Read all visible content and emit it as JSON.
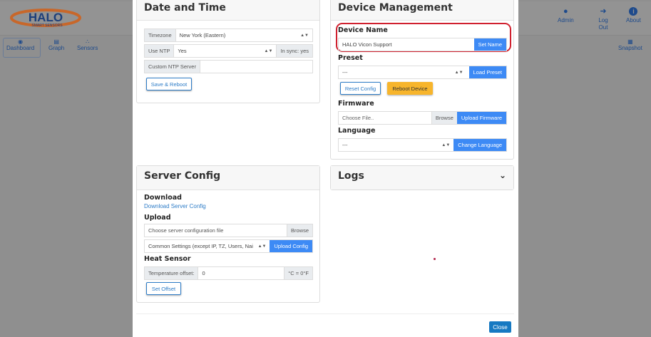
{
  "app": {
    "logo_text": "HALO",
    "logo_sub": "SMART SENSORS"
  },
  "nav": [
    {
      "label": "Dashboard",
      "icon": "dashboard-icon"
    },
    {
      "label": "Graph",
      "icon": "graph-icon"
    },
    {
      "label": "Sensors",
      "icon": "sensors-icon"
    }
  ],
  "header_actions": [
    {
      "label": "Admin",
      "icon": "user-icon"
    },
    {
      "label": "Log Out",
      "icon": "logout-icon"
    },
    {
      "label": "About",
      "icon": "info-icon"
    }
  ],
  "snapshot": {
    "label": "Snapshot",
    "icon": "snapshot-icon"
  },
  "datetime": {
    "title": "Date and Time",
    "timezone_label": "Timezone",
    "timezone_value": "New York (Eastern)",
    "ntp_label": "Use NTP",
    "ntp_value": "Yes",
    "sync_status": "In sync: yes",
    "custom_ntp_label": "Custom NTP Server",
    "custom_ntp_value": "",
    "save_label": "Save & Reboot"
  },
  "device": {
    "title": "Device Management",
    "name_label": "Device Name",
    "name_value": "HALO Vicon Support",
    "set_name": "Set Name",
    "preset_label": "Preset",
    "preset_value": "---",
    "load_preset": "Load Preset",
    "reset_config": "Reset Config",
    "reboot": "Reboot Device",
    "firmware_label": "Firmware",
    "firmware_placeholder": "Choose File..",
    "browse": "Browse",
    "upload_firmware": "Upload Firmware",
    "language_label": "Language",
    "language_value": "---",
    "change_language": "Change Language"
  },
  "server": {
    "title": "Server Config",
    "download_label": "Download",
    "download_link": "Download Server Config",
    "upload_label": "Upload",
    "file_placeholder": "Choose server configuration file",
    "browse": "Browse",
    "mode_value": "Common Settings (except IP, TZ, Users, Nai",
    "upload_config": "Upload Config",
    "heat_label": "Heat Sensor",
    "temp_label": "Temperature offset:",
    "temp_value": "0",
    "temp_unit": "°C = 0°F",
    "set_offset": "Set Offset"
  },
  "logs": {
    "title": "Logs"
  },
  "footer": {
    "close": "Close"
  },
  "colors": {
    "primary": "#3d8af5",
    "warning": "#f7b52c",
    "highlight": "#d0202e"
  }
}
